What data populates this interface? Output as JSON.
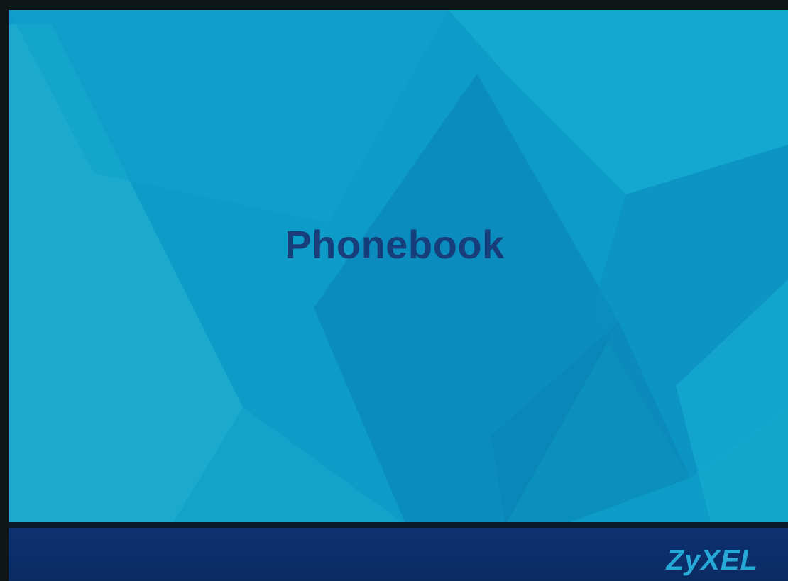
{
  "screen": {
    "title": "Phonebook"
  },
  "footer": {
    "brand": "ZyXEL"
  },
  "colors": {
    "background": "#0c9bc6",
    "title_text": "#173e7a",
    "footer_bar": "#0f3270",
    "brand": "#27a9d8"
  }
}
